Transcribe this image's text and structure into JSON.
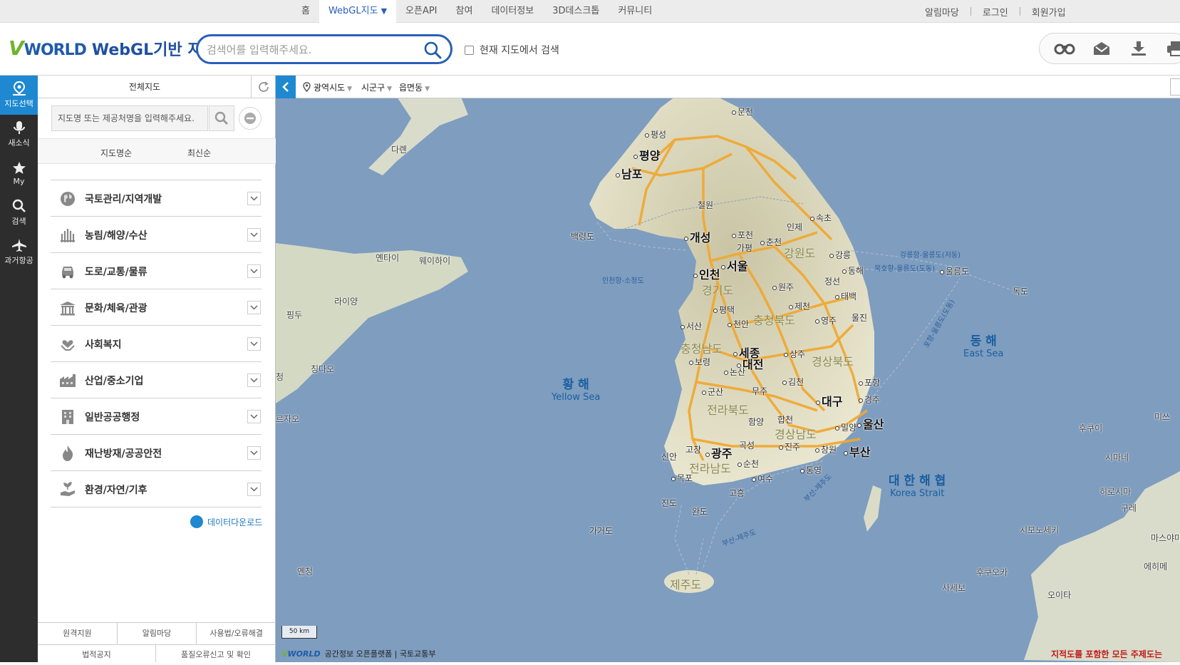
{
  "topnav": {
    "items": [
      "홈",
      "WebGL지도",
      "오픈API",
      "참여",
      "데이터정보",
      "3D데스크톱",
      "커뮤니티"
    ],
    "active_caret": "▼",
    "util": [
      "알림마당",
      "로그인",
      "회원가입"
    ]
  },
  "header": {
    "logo_v": "V",
    "logo_world": "WORLD",
    "logo_title": "WebGL기반 지도",
    "search_placeholder": "검색어를 입력해주세요.",
    "map_search_label": "현재 지도에서 검색",
    "tools": [
      "binoculars-icon",
      "mail-icon",
      "download-icon",
      "print-icon"
    ]
  },
  "rail": {
    "items": [
      "지도선택",
      "새소식",
      "My",
      "검색",
      "과거항공"
    ]
  },
  "panel": {
    "tab_label": "전체지도",
    "search_placeholder": "지도명 또는 제공처명을 입력해주세요.",
    "sort_name": "지도명순",
    "sort_recent": "최신순",
    "categories": [
      "국토관리/지역개발",
      "농림/해양/수산",
      "도로/교통/물류",
      "문화/체육/관광",
      "사회복지",
      "산업/중소기업",
      "일반공공행정",
      "재난방재/공공안전",
      "환경/자연/기후"
    ],
    "download_label": "데이터다운로드",
    "footer_row1": [
      "원격지원",
      "알림마당",
      "사용법/오류해결"
    ],
    "footer_row2": [
      "법적공지",
      "품질오류신고 및 확인"
    ]
  },
  "map": {
    "address": [
      "광역시도",
      "시군구",
      "읍면동"
    ],
    "scale": "50 km",
    "attribution": "공간정보 오픈플랫폼 | 국토교통부",
    "attrib_logo": "WORLD",
    "notice": "지적도를 포함한 모든 주제도는",
    "seas": [
      {
        "ko": "황 해",
        "en": "Yellow Sea"
      },
      {
        "ko": "동 해",
        "en": "East Sea"
      },
      {
        "ko": "대 한 해 협",
        "en": "Korea Strait"
      }
    ],
    "cities_major": [
      "평양",
      "남포",
      "개성",
      "서울",
      "인천",
      "세종",
      "대전",
      "대구",
      "울산",
      "광주",
      "부산"
    ],
    "provinces": [
      "강원도",
      "경기도",
      "충청북도",
      "충청남도",
      "경상북도",
      "전라북도",
      "경상남도",
      "전라남도",
      "제주도"
    ],
    "towns": [
      "문천",
      "평성",
      "철원",
      "속초",
      "인제",
      "포천",
      "춘천",
      "가평",
      "강릉",
      "동해",
      "원주",
      "정선",
      "제천",
      "태백",
      "평택",
      "영주",
      "울진",
      "서산",
      "천안",
      "상주",
      "포항",
      "보령",
      "논산",
      "김천",
      "무주",
      "군산",
      "경주",
      "함양",
      "합천",
      "밀양",
      "고창",
      "곡성",
      "진주",
      "창원",
      "신안",
      "순천",
      "목포",
      "여수",
      "통영",
      "고흥",
      "진도",
      "완도",
      "백령도",
      "울릉도",
      "독도",
      "가거도"
    ],
    "foreign": [
      "다롄",
      "옌타이",
      "웨이하이",
      "라이양",
      "핑두",
      "칭다오",
      "청",
      "르자오",
      "옌청",
      "후쿠오카",
      "사세보",
      "시마네",
      "히로시마",
      "구레",
      "시모노세키",
      "마스야마",
      "에히메",
      "오이타",
      "미쓰",
      "후쿠이"
    ],
    "routes": [
      "인천항-소청도",
      "강릉항-울릉도(저동)",
      "묵호항-울릉도(도동)",
      "포항-울릉도(도동)",
      "부산-제주도",
      "부산-제주도"
    ]
  }
}
